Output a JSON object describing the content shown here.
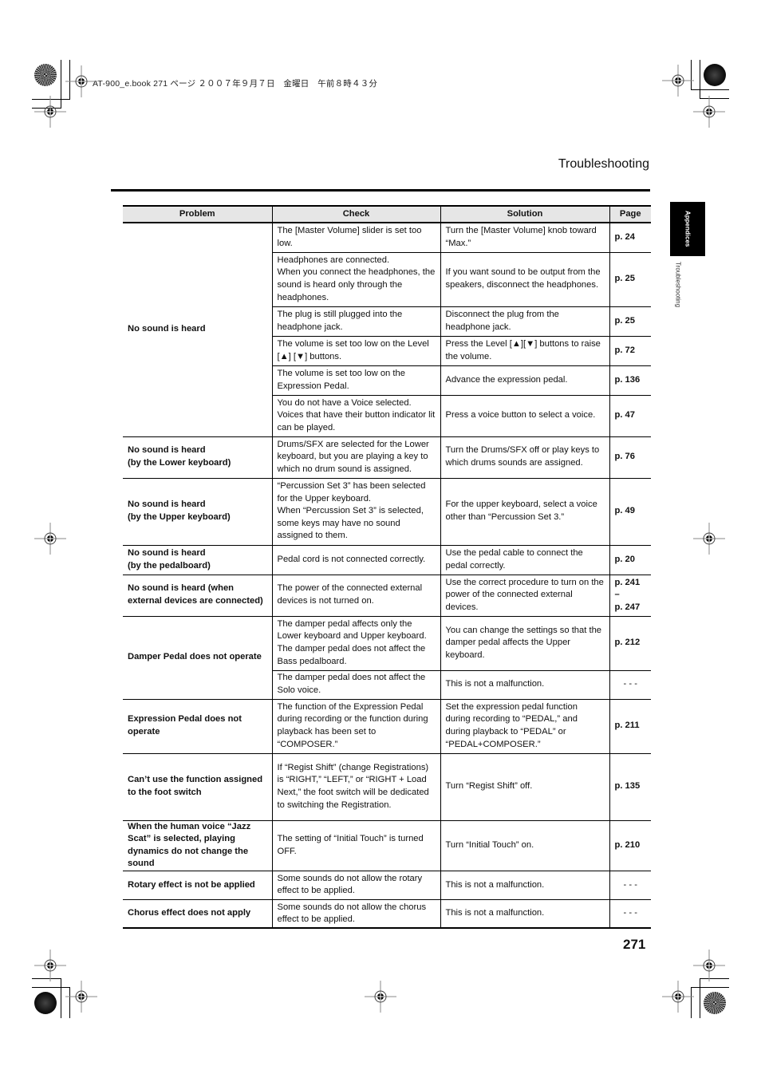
{
  "slug_line": "AT-900_e.book  271 ページ  ２００７年９月７日　金曜日　午前８時４３分",
  "header": {
    "title": "Troubleshooting"
  },
  "side_tab": {
    "section": "Appendices",
    "subsection": "Troubleshooting"
  },
  "table": {
    "columns": [
      "Problem",
      "Check",
      "Solution",
      "Page"
    ],
    "groups": [
      {
        "problem": "No sound is heard",
        "rows": [
          {
            "check": "The [Master Volume] slider is set too low.",
            "solution": "Turn the [Master Volume] knob toward “Max.”",
            "page": "p. 24"
          },
          {
            "check": "Headphones are connected.\nWhen you connect the headphones, the sound is heard only through the headphones.",
            "solution": "If you want sound to be output from the speakers, disconnect the headphones.",
            "page": "p. 25"
          },
          {
            "check": "The plug is still plugged into the headphone jack.",
            "solution": "Disconnect the plug from the headphone jack.",
            "page": "p. 25"
          },
          {
            "check": "The volume is set too low on the Level [▲] [▼] buttons.",
            "solution": "Press the Level [▲][▼] buttons to raise the volume.",
            "page": "p. 72"
          },
          {
            "check": "The volume is set too low on the Expression Pedal.",
            "solution": "Advance the expression pedal.",
            "page": "p. 136"
          },
          {
            "check": "You do not have a Voice selected.\nVoices that have their button indicator lit can be played.",
            "solution": "Press a voice button to select a voice.",
            "page": "p. 47"
          }
        ]
      },
      {
        "problem": "No sound is heard\n(by the Lower keyboard)",
        "rows": [
          {
            "check": "Drums/SFX are selected for the Lower keyboard, but you are playing a key to which no drum sound is assigned.",
            "solution": "Turn the Drums/SFX off or play keys to which drums sounds are assigned.",
            "page": "p. 76"
          }
        ]
      },
      {
        "problem": "No sound is heard\n(by the Upper keyboard)",
        "rows": [
          {
            "check": "“Percussion Set 3” has been selected for the Upper keyboard.\nWhen “Percussion Set 3” is selected, some keys may have no sound assigned to them.",
            "solution": "For the upper keyboard, select a voice other than “Percussion Set 3.”",
            "page": "p. 49"
          }
        ]
      },
      {
        "problem": "No sound is heard\n(by the pedalboard)",
        "rows": [
          {
            "check": "Pedal cord is not connected correctly.",
            "solution": "Use the pedal cable to connect the pedal correctly.",
            "page": "p. 20"
          }
        ]
      },
      {
        "problem": "No sound is heard (when external devices are connected)",
        "rows": [
          {
            "check": "The power of the connected external devices is not turned on.",
            "solution": "Use the correct procedure to turn on the power of the connected external devices.",
            "page": "p. 241\n–\np. 247"
          }
        ]
      },
      {
        "problem": "Damper Pedal does not operate",
        "rows": [
          {
            "check": "The damper pedal affects only the Lower keyboard and Upper keyboard. The damper pedal does not affect the Bass pedalboard.",
            "solution": "You can change the settings so that the damper pedal affects the Upper keyboard.",
            "page": "p. 212"
          },
          {
            "check": "The damper pedal does not affect the Solo voice.",
            "solution": "This is not a malfunction.",
            "page": "- - -"
          }
        ]
      },
      {
        "problem": "Expression Pedal does not operate",
        "rows": [
          {
            "check": "The function of the Expression Pedal during recording or the function during playback has been set to “COMPOSER.”",
            "solution": "Set the expression pedal function during recording to “PEDAL,” and during playback to “PEDAL” or “PEDAL+COMPOSER.”",
            "page": "p. 211"
          }
        ]
      },
      {
        "problem": "Can’t use the function assigned to the foot switch",
        "rows": [
          {
            "check": "If “Regist Shift” (change Registrations) is “RIGHT,” “LEFT,” or “RIGHT + Load Next,” the foot switch will be dedicated to switching the Registration.",
            "solution": "Turn “Regist Shift” off.",
            "page": "p. 135"
          }
        ]
      },
      {
        "problem": "When the human voice “Jazz Scat” is selected, playing dynamics do not change the sound",
        "rows": [
          {
            "check": "The setting of “Initial Touch” is turned OFF.",
            "solution": "Turn “Initial Touch” on.",
            "page": "p. 210"
          }
        ]
      },
      {
        "problem": "Rotary effect is not be applied",
        "rows": [
          {
            "check": "Some sounds do not allow the rotary effect to be applied.",
            "solution": "This is not a malfunction.",
            "page": "- - -"
          }
        ]
      },
      {
        "problem": "Chorus effect does not apply",
        "rows": [
          {
            "check": "Some sounds do not allow the chorus effect to be applied.",
            "solution": "This is not a malfunction.",
            "page": "- - -"
          }
        ]
      }
    ]
  },
  "footer": {
    "page_number": "271"
  }
}
